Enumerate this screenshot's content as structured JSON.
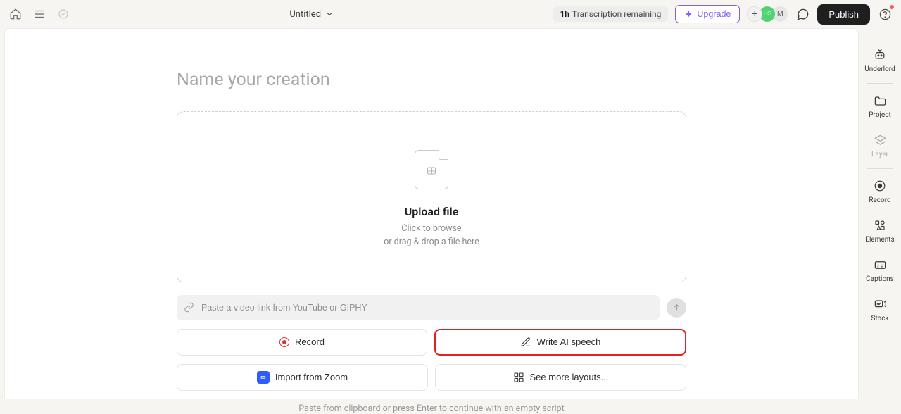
{
  "topbar": {
    "title": "Untitled",
    "transcription_prefix": "1h",
    "transcription_label": "Transcription remaining",
    "upgrade_label": "Upgrade",
    "avatar_plus": "+",
    "avatar_a": "HS",
    "avatar_b": "M",
    "publish_label": "Publish"
  },
  "editor": {
    "title_placeholder": "Name your creation",
    "upload": {
      "title": "Upload file",
      "line1": "Click to browse",
      "line2": "or drag & drop a file here"
    },
    "link_placeholder": "Paste a video link from YouTube or GIPHY",
    "buttons": {
      "record": "Record",
      "write_ai": "Write AI speech",
      "zoom": "Import from Zoom",
      "layouts": "See more layouts..."
    },
    "paste_hint": "Paste from clipboard or press Enter to continue with an empty script"
  },
  "rail": {
    "items": [
      {
        "label": "Underlord"
      },
      {
        "label": "Project"
      },
      {
        "label": "Layer"
      },
      {
        "label": "Record"
      },
      {
        "label": "Elements"
      },
      {
        "label": "Captions"
      },
      {
        "label": "Stock"
      }
    ]
  }
}
